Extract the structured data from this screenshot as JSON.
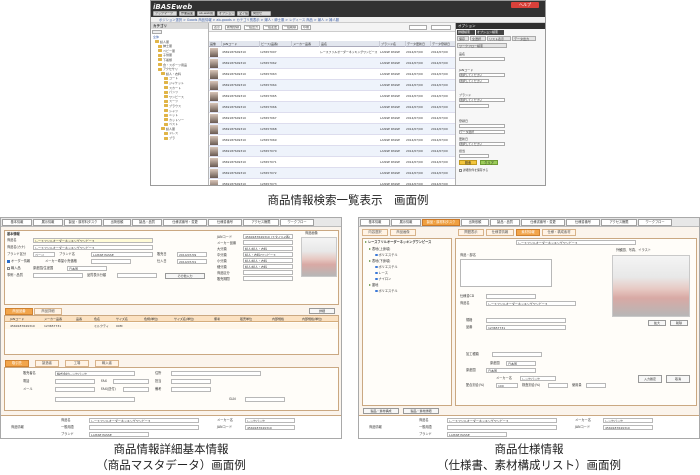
{
  "captions": {
    "top": "商品情報検索一覧表示　画面例",
    "bottom_left_line1": "商品情報詳細基本情報",
    "bottom_left_line2": "（商品マスタデータ）画面例",
    "bottom_right_line1": "商品仕様情報",
    "bottom_right_line2": "（仕様書、素材構成リスト）画面例"
  },
  "top_screen": {
    "logo_prefix": "i",
    "logo": "BASEweb",
    "help_label": "ヘルプ",
    "menu_buttons": [
      "ブックマーク",
      "作業画面",
      "ab-web用",
      "オプション",
      "マイ設定",
      "問合せ"
    ],
    "breadcrumb": "ポジション選択 > Goods 商品情報 > ab-goods > カテゴリ別表示 > 婦人・紳士服 > レディース 商品 > 婦人 > 婦人服",
    "category_panel_title": "カテゴリ",
    "tree_items": [
      "全体",
      "婦人服",
      "紳士服",
      "ベビー服",
      "子供服",
      "下着類",
      "食・スポーツ用品",
      "アクセサリ",
      "婦人・衣料",
      "コート",
      "ジャケット",
      "スカート",
      "パンツ",
      "ワンピース",
      "スーツ",
      "ブラウス",
      "シャツ",
      "ニット",
      "カットソー",
      "ベスト",
      "婦人服",
      "ドレス",
      "ブラ"
    ],
    "toolbar_buttons": [
      "表示",
      "新規登録",
      "一括出力",
      "一括変更",
      "一括削除",
      "印刷"
    ],
    "headers": [
      "画像",
      "JANコード",
      "ピース(品番)",
      "メーカー品番",
      "品名",
      "ブランド名",
      "データ更新日",
      "データ登録日"
    ],
    "rows": [
      {
        "jan": "4569187649310",
        "piece": "123657007",
        "name": "レースフリルオーダーネッキングワンピース",
        "brand": "LAISSE PASSE",
        "upd": "2014/07/09",
        "reg": "2014/07/09"
      },
      {
        "jan": "4569187649310",
        "piece": "123657062",
        "name": "",
        "brand": "LAISSE PASSE",
        "upd": "2014/07/09",
        "reg": "2014/07/09"
      },
      {
        "jan": "4569187649310",
        "piece": "123657063",
        "name": "",
        "brand": "LAISSE PASSE",
        "upd": "2014/07/09",
        "reg": "2014/07/09"
      },
      {
        "jan": "4569187649310",
        "piece": "123657064",
        "name": "",
        "brand": "LAISSE PASSE",
        "upd": "2014/07/09",
        "reg": "2014/07/09"
      },
      {
        "jan": "4569187649310",
        "piece": "123657065",
        "name": "",
        "brand": "LAISSE PASSE",
        "upd": "2014/07/09",
        "reg": "2014/07/09"
      },
      {
        "jan": "4569187649310",
        "piece": "123657066",
        "name": "",
        "brand": "LAISSE PASSE",
        "upd": "2014/07/09",
        "reg": "2014/07/09"
      },
      {
        "jan": "4569187649310",
        "piece": "123657067",
        "name": "",
        "brand": "LAISSE PASSE",
        "upd": "2014/07/09",
        "reg": "2014/07/09"
      },
      {
        "jan": "4569187649310",
        "piece": "123657068",
        "name": "",
        "brand": "LAISSE PASSE",
        "upd": "2014/07/09",
        "reg": "2014/07/09"
      },
      {
        "jan": "4569187649310",
        "piece": "123657069",
        "name": "",
        "brand": "LAISSE PASSE",
        "upd": "2014/07/09",
        "reg": "2014/07/09"
      },
      {
        "jan": "4569187649310",
        "piece": "123657070",
        "name": "",
        "brand": "LAISSE PASSE",
        "upd": "2014/07/09",
        "reg": "2014/07/09"
      },
      {
        "jan": "4569187649310",
        "piece": "123657071",
        "name": "",
        "brand": "LAISSE PASSE",
        "upd": "2014/07/09",
        "reg": "2014/07/09"
      },
      {
        "jan": "4569187649310",
        "piece": "123657072",
        "name": "",
        "brand": "LAISSE PASSE",
        "upd": "2014/07/09",
        "reg": "2014/07/09"
      },
      {
        "jan": "4569187649310",
        "piece": "123657073",
        "name": "",
        "brand": "LAISSE PASSE",
        "upd": "2014/07/09",
        "reg": "2014/07/09"
      }
    ],
    "options_title": "オプション",
    "options_tabs": [
      "詳細検索",
      "オプション検索"
    ],
    "options_subtabs": [
      "保存",
      "全選択",
      "リスト表示",
      "データ出力"
    ],
    "options_section": "ワークフロー検索",
    "options_fields": [
      "品名",
      "JANコード",
      "ブランド",
      "登録日",
      "更新日",
      "担当"
    ],
    "options_selects": [
      "選択してください",
      "選択してください",
      "選択してください",
      "データ選択",
      "選択してください"
    ],
    "search_button": "検索",
    "clear_button": "クリア",
    "options_note": "詳細条件を保存する"
  },
  "bl_screen": {
    "tabs": [
      "基本情報",
      "展示情報",
      "製品・原材料タスク",
      "出荷依頼",
      "製品・品質",
      "仕様書番号・変更",
      "仕様書番号",
      "アクセス権限",
      "ワークフロー"
    ],
    "f_label_code": "基本情報",
    "f_label_name": "商品名",
    "f_name": "レースフリルオーダーネッキングワンピース",
    "f_label_name2": "商品名(カナ)",
    "f_name2": "レースフリルオーダーネッキングワンピース",
    "f_label_brand_code": "ブランド区分",
    "f_brand_code": "ページ",
    "f_label_brand": "ブランド名",
    "f_brand": "LAISSE PASSE",
    "f_label_sale": "販売日",
    "f_sale": "2014/07/09",
    "f_label_order": "オーダー情報",
    "f_order": "メーカー希望小売価格",
    "f_label_stock": "仕入日",
    "f_stock": "2014/07/01",
    "f_label_import": "輸入品",
    "f_import": "原産国/生産国",
    "f_label_origin": "日本国",
    "f_label_type": "事例・品質",
    "f_type": "品質表示分類",
    "f_more": "その他入力",
    "kv": [
      {
        "k": "JANコード",
        "v": "4569187649310 (スタイル2番)"
      },
      {
        "k": "メーカー品番",
        "v": ""
      },
      {
        "k": "大分類",
        "v": "婦人/婦人・衣料"
      },
      {
        "k": "中分類",
        "v": "婦人・衣料/ワンピース"
      },
      {
        "k": "小分類",
        "v": "婦人/婦人・衣料"
      },
      {
        "k": "細分類",
        "v": "婦人/婦人・衣料"
      },
      {
        "k": "商品区分",
        "v": ""
      },
      {
        "k": "販売期間",
        "v": ""
      }
    ],
    "image_label": "商品画像",
    "grid_tabs": [
      "商品品番",
      "商品詳細"
    ],
    "grid_btn": "詳細",
    "grid_headers": [
      "JANコード",
      "メーカー品番",
      "品番",
      "色名",
      "サイズ名",
      "色柄(単位)",
      "サイズ名(単位)",
      "備考",
      "販売単位",
      "内部規格",
      "内部規格(単位)"
    ],
    "grid_row": [
      "4569187649310",
      "123657731",
      "",
      "ミルクティ",
      "00M",
      "",
      "",
      "",
      "",
      "",
      ""
    ],
    "lower_tabs": [
      "取引先",
      "製造者",
      "工場",
      "輸入者"
    ],
    "lower_labels": [
      "販売者名",
      "住所",
      "電話",
      "FAX",
      "担当",
      "メール",
      "FAX(送付)",
      "備考",
      "GLN"
    ],
    "lower_company": "株式会社レッセパッセ",
    "footer_labels": [
      "商品情報",
      "商品名",
      "一般用語",
      "ブランド",
      "メーカー名",
      "JANコード"
    ],
    "footer_values": [
      "レースフリルオーダーネッキングワンピース",
      "",
      "LAISSE PASSE",
      "レッセパッセ",
      "4569187649310"
    ]
  },
  "br_screen": {
    "tabs": [
      "基本情報",
      "展示情報",
      "製品・原材料タスク",
      "出荷依頼",
      "製品・品質",
      "仕様書番号・変更",
      "仕様書番号",
      "アクセス権限",
      "ワークフロー"
    ],
    "subtabs": [
      "内容選択",
      "商品画像",
      "問題表示",
      "仕様書情報",
      "素材情報",
      "仕様・構成素材"
    ],
    "tree_title": "レースフリルオーダーネッキングワンピース",
    "tree": [
      "表地(上身頃)",
      "ポリエステル",
      "表地(下身頃)",
      "ポリエステル",
      "レース",
      "ナイロン",
      "裏地",
      "ポリエステル"
    ],
    "spec_title": "レースフリルオーダーネッキングワンピース",
    "f_label_partname": "商品・部名",
    "f_label_code": "仕様書CD",
    "f_label_name": "商品名",
    "f_name": "レースフリルオーダーネッキングワンピース",
    "f_label_size": "規格",
    "f_label_no": "品番",
    "f_no": "123657731",
    "f_label_process": "加工種類",
    "f_label_origin": "原産国",
    "f_origin": "日本国",
    "f_label_maker": "原産国",
    "f_origin2": "日本国",
    "f_label_mname": "メーカー名",
    "f_mname": "レッセパッセ",
    "f_label_ratio": "配合割合(%)",
    "f_ratio": "100",
    "f_label_ratio2": "検査割合(%)",
    "f_label_use": "使用量",
    "img_caption": "外観図、写真、イラスト",
    "img_btns": [
      "拡大",
      "削除"
    ],
    "right_btns": [
      "入力確定",
      "取消"
    ],
    "bottom_btns": [
      "製品・素材構成",
      "製品・素材詳細"
    ],
    "footer_labels": [
      "商品情報",
      "商品名",
      "一般用語",
      "ブランド",
      "メーカー名",
      "JANコード"
    ],
    "footer_values": [
      "レースフリルオーダーネッキングワンピース",
      "",
      "LAISSE PASSE",
      "レッセパッセ",
      "4569187649310"
    ]
  }
}
